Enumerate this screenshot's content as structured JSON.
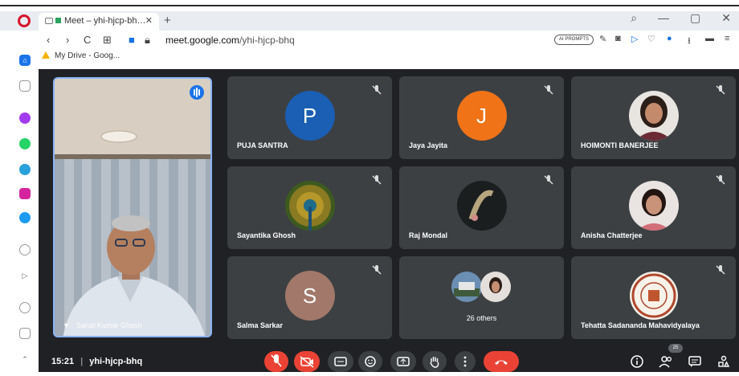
{
  "browser": {
    "tab_title": "Meet – yhi-hjcp-bh…",
    "address_domain": "meet.google.com",
    "address_path": "/yhi-hjcp-bhq",
    "ai_prompts_label": "AI PROMPTS",
    "bookmark_label": "My Drive - Goog..."
  },
  "meeting": {
    "time": "15:21",
    "code": "yhi-hjcp-bhq",
    "participant_count": "25",
    "presenter_name": "Sanat Kumar Ghosh",
    "others_label": "26 others"
  },
  "tiles": [
    {
      "name": "PUJA SANTRA",
      "initial": "P",
      "color": "#1a5fb4"
    },
    {
      "name": "Jaya Jayita",
      "initial": "J",
      "color": "#f07318"
    },
    {
      "name": "HOIMONTI BANERJEE",
      "initial": "",
      "color": ""
    },
    {
      "name": "Sayantika Ghosh",
      "initial": "",
      "color": ""
    },
    {
      "name": "Raj Mondal",
      "initial": "",
      "color": ""
    },
    {
      "name": "Anisha Chatterjee",
      "initial": "",
      "color": ""
    },
    {
      "name": "Salma Sarkar",
      "initial": "S",
      "color": "#a1786a"
    },
    {
      "name": "Tehatta Sadananda Mahavidyalaya",
      "initial": "",
      "color": ""
    }
  ],
  "colors": {
    "meet_background": "#202124",
    "tile_background": "#3c4043",
    "end_call_red": "#ea4335",
    "accent_blue": "#8ab4f8"
  }
}
